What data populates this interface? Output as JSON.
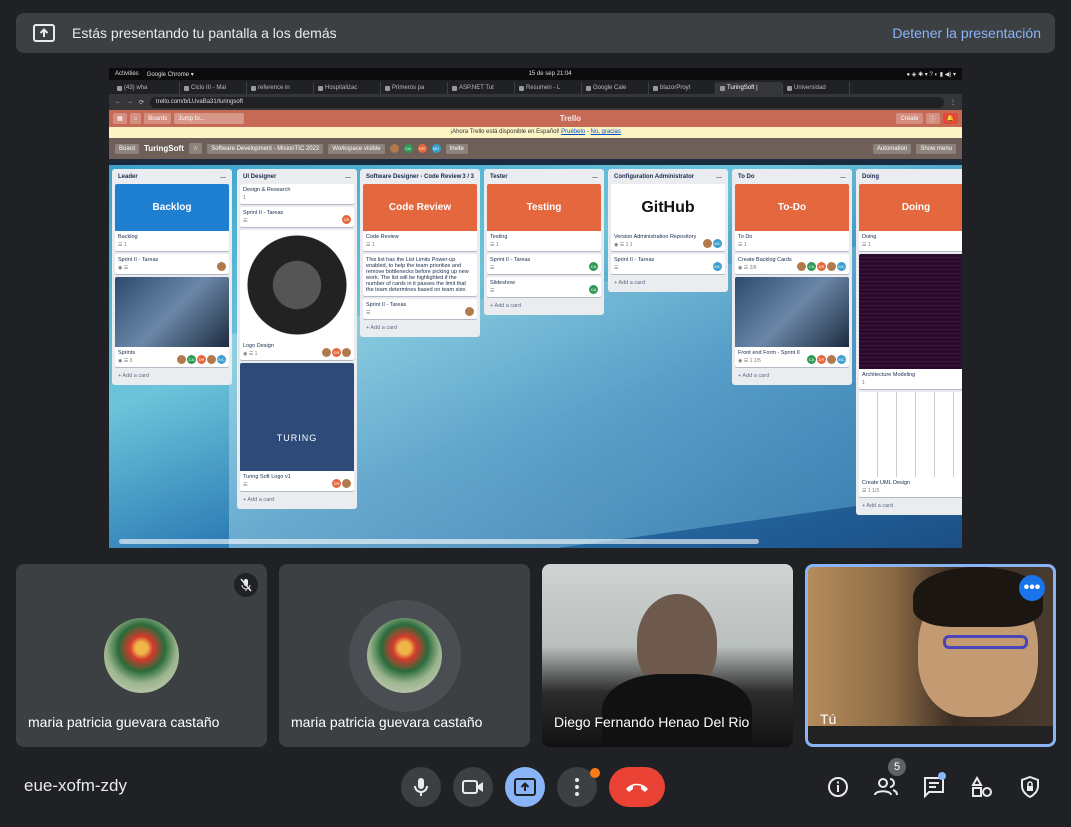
{
  "banner": {
    "message": "Estás presentando tu pantalla a los demás",
    "stop_label": "Detener la presentación"
  },
  "shared_screen": {
    "gnome": {
      "activities": "Activities",
      "app": "Google Chrome ▾",
      "clock": "15 de sep  21:04"
    },
    "tabs": [
      "(43) wha",
      "Ciclo III - Mal",
      "reference in",
      "Hospitalizac",
      "Primeros pa",
      "ASP.NET Tut",
      "Resumen - L",
      "Google Cale",
      "blazorProyt",
      "TuringSoft |",
      "Universidad"
    ],
    "active_tab_index": 9,
    "url": "trello.com/b/LUvaBa31/turingsoft",
    "trello": {
      "boards_label": "Boards",
      "search_placeholder": "Jump to...",
      "logo": "Trello",
      "create_label": "Create",
      "notice_text": "¡Ahora Trello está disponible en Español!",
      "notice_link1": "Pruébelo",
      "notice_link2": "No, gracias",
      "board_view": "Board",
      "board_name": "TuringSoft",
      "workspace": "Software Development - MisionTIC 2022",
      "visibility": "Workspace visible",
      "invite": "Invite",
      "automation": "Automation",
      "show_menu": "Show menu",
      "add_card": "+ Add a card",
      "lists": [
        {
          "title": "Leader",
          "count": "",
          "cards": [
            {
              "cover_text": "Backlog",
              "cover": "blue",
              "title": "Backlog",
              "meta": "☰  1"
            },
            {
              "title": "Sprint II - Tareas",
              "meta": "◉  ☰"
            },
            {
              "thumb": true,
              "title": "Sprints",
              "meta": "◉  ☰  3"
            }
          ]
        },
        {
          "title": "UI Designer",
          "count": "",
          "cards": [
            {
              "title": "Design & Research",
              "meta": "1"
            },
            {
              "title": "Sprint II - Tareas",
              "meta": "☰"
            },
            {
              "logo_img": "turing",
              "title": "Logo Design",
              "meta": "◉ ☰  1"
            },
            {
              "poster": "TURING",
              "title": "Turing Soft Logo v1",
              "meta": "☰"
            }
          ]
        },
        {
          "title": "Software Designer - Code Review",
          "count": "3 / 3",
          "cards": [
            {
              "cover_text": "Code Review",
              "cover": "orange",
              "title": "Code Review",
              "meta": "☰  1"
            },
            {
              "title": "This list has the List Limits Power-up enabled, to help the team prioritize and remove bottlenecks before picking up new work. The list will be highlighted if the number of cards in it passes the limit that the team determines based on team size.",
              "meta": ""
            },
            {
              "title": "Sprint II - Tareas",
              "meta": "☰"
            }
          ]
        },
        {
          "title": "Tester",
          "count": "",
          "cards": [
            {
              "cover_text": "Testing",
              "cover": "orange",
              "title": "Testing",
              "meta": "☰  1"
            },
            {
              "title": "Sprint II - Tareas",
              "meta": "☰"
            },
            {
              "title": "Slideshow",
              "meta": "☰"
            }
          ]
        },
        {
          "title": "Configuration Administrator",
          "count": "",
          "cards": [
            {
              "cover_text": "GitHub",
              "cover": "white",
              "title": "Version Administration Repository",
              "meta": "◉ ☰ 1  1"
            },
            {
              "title": "Sprint II - Tareas",
              "meta": "☰"
            }
          ]
        },
        {
          "title": "To Do",
          "count": "",
          "cards": [
            {
              "cover_text": "To-Do",
              "cover": "orange",
              "title": "To Do",
              "meta": "☰  1"
            },
            {
              "title": "Create Backlog Cards",
              "meta": "◉ ☰  2/6"
            },
            {
              "thumb": true,
              "title": "Front end Form - Sprint II",
              "meta": "◉ ☰  1  1/5"
            }
          ]
        },
        {
          "title": "Doing",
          "count": "",
          "cards": [
            {
              "cover_text": "Doing",
              "cover": "orange",
              "title": "Doing",
              "meta": "☰  1"
            },
            {
              "code": true,
              "title": "Architecture Modeling",
              "meta": "1"
            },
            {
              "uml": true,
              "title": "Create UML Design",
              "meta": "☰  1  1/3"
            }
          ]
        }
      ]
    }
  },
  "participants": [
    {
      "name": "maria patricia guevara castaño",
      "muted": true
    },
    {
      "name": "maria patricia guevara castaño",
      "muted": false
    },
    {
      "name": "Diego Fernando Henao Del Rio"
    },
    {
      "name": "Tú"
    }
  ],
  "meeting_code": "eue-xofm-zdy",
  "people_count": "5",
  "colors": {
    "accent": "#8ab4f8",
    "end_call": "#ea4335",
    "bg": "#202124",
    "tile": "#3c4043"
  }
}
